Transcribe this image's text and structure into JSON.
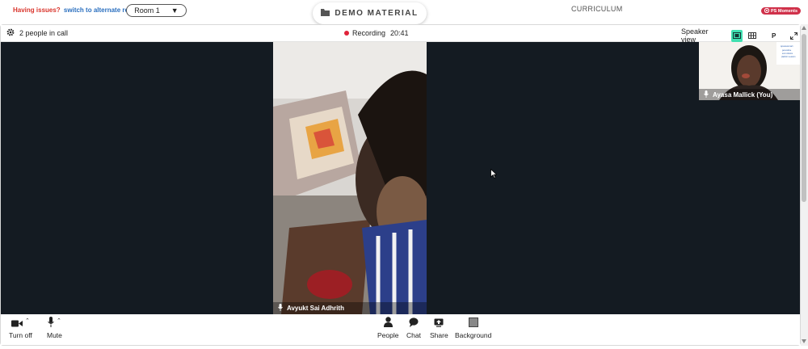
{
  "header": {
    "issues_text": "Having issues?",
    "alternate_link": "switch to alternate room",
    "room_select": "Room 1",
    "demo_material": "DEMO MATERIAL",
    "curriculum": "CURRICULUM",
    "moments_badge": "PS Moments"
  },
  "callbar": {
    "people_count": "2 people in call",
    "recording_label": "Recording",
    "recording_time": "20:41",
    "view_mode": "Speaker view",
    "p_button": "P"
  },
  "participants": {
    "main": {
      "name": "Avyukt Sai Adhrith"
    },
    "self": {
      "name": "Ayasa Mallick (You)",
      "screen_text": "spacesmart · generative · ai & robotics · platform session"
    }
  },
  "toolbar": {
    "camera": "Turn off",
    "mute": "Mute",
    "people": "People",
    "chat": "Chat",
    "share": "Share",
    "background": "Background"
  },
  "icons": {
    "settings": "gear-icon",
    "folder": "folder-icon",
    "camera": "video-camera-icon",
    "mic": "microphone-icon",
    "people": "person-icon",
    "chat": "chat-bubble-icon",
    "share": "share-screen-icon",
    "background": "background-icon",
    "speaker_view": "speaker-view-icon",
    "grid_view": "grid-view-icon",
    "fullscreen": "fullscreen-icon"
  },
  "colors": {
    "accent_green": "#3fe0b0",
    "recording_red": "#e0233a",
    "issues_red": "#d9342b",
    "link_blue": "#2a6fbf",
    "stage_bg": "#141b22",
    "moments_pink": "#d0314a"
  }
}
